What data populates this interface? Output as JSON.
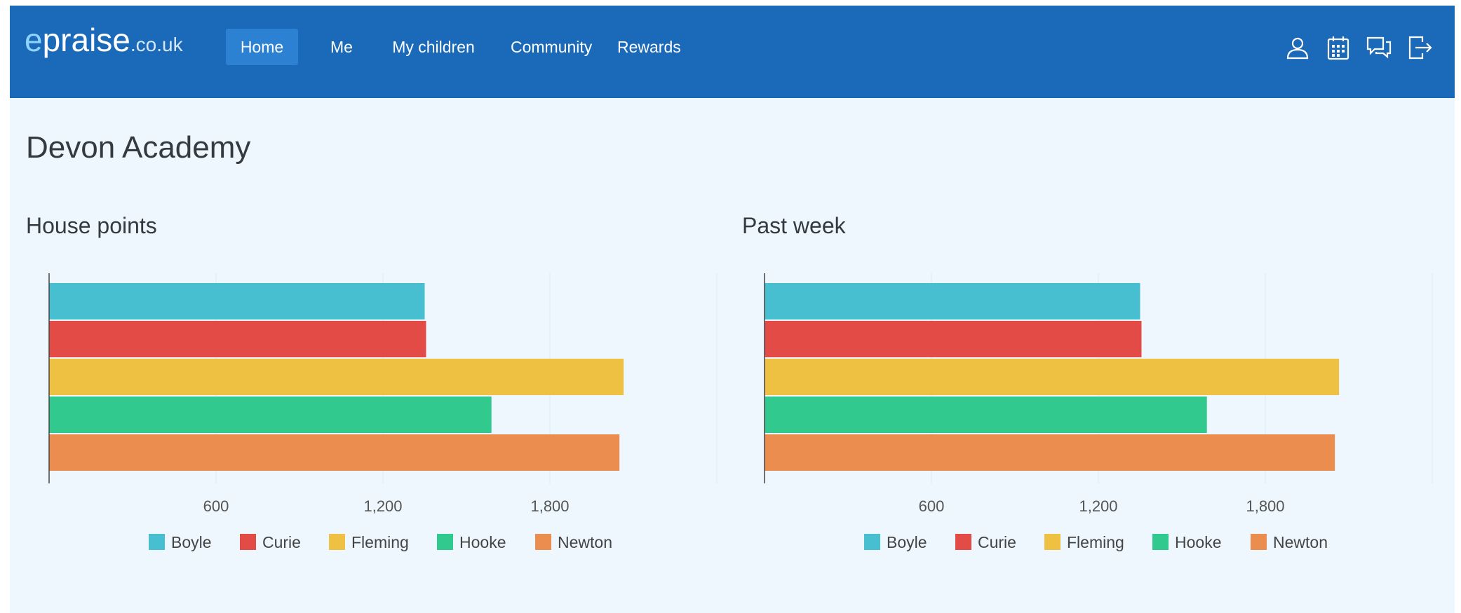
{
  "brand": {
    "prefix": "e",
    "name": "praise",
    "domain": ".co.uk"
  },
  "nav": {
    "items": [
      {
        "label": "Home",
        "active": true
      },
      {
        "label": "Me",
        "active": false
      },
      {
        "label": "My children",
        "active": false
      },
      {
        "label": "Community",
        "active": false
      },
      {
        "label": "Rewards",
        "active": false
      }
    ],
    "icons": [
      "user-icon",
      "calendar-icon",
      "messages-icon",
      "logout-icon"
    ]
  },
  "page": {
    "title": "Devon Academy"
  },
  "colors": {
    "navbar": "#1b69b9",
    "background": "#eef7fd",
    "Boyle": "#48bfd0",
    "Curie": "#e24b46",
    "Fleming": "#efc142",
    "Hooke": "#31c98d",
    "Newton": "#ec8d50"
  },
  "chart_data": [
    {
      "type": "bar",
      "orientation": "horizontal",
      "title": "House points",
      "categories": [
        "Boyle",
        "Curie",
        "Fleming",
        "Hooke",
        "Newton"
      ],
      "values": [
        1350,
        1355,
        2065,
        1590,
        2050
      ],
      "xlim": [
        0,
        2400
      ],
      "xticks": [
        600,
        1200,
        1800
      ],
      "xtick_labels": [
        "600",
        "1,200",
        "1,800"
      ],
      "grid": true,
      "legend": "bottom"
    },
    {
      "type": "bar",
      "orientation": "horizontal",
      "title": "Past week",
      "categories": [
        "Boyle",
        "Curie",
        "Fleming",
        "Hooke",
        "Newton"
      ],
      "values": [
        1350,
        1355,
        2065,
        1590,
        2050
      ],
      "xlim": [
        0,
        2400
      ],
      "xticks": [
        600,
        1200,
        1800
      ],
      "xtick_labels": [
        "600",
        "1,200",
        "1,800"
      ],
      "grid": true,
      "legend": "bottom"
    }
  ]
}
